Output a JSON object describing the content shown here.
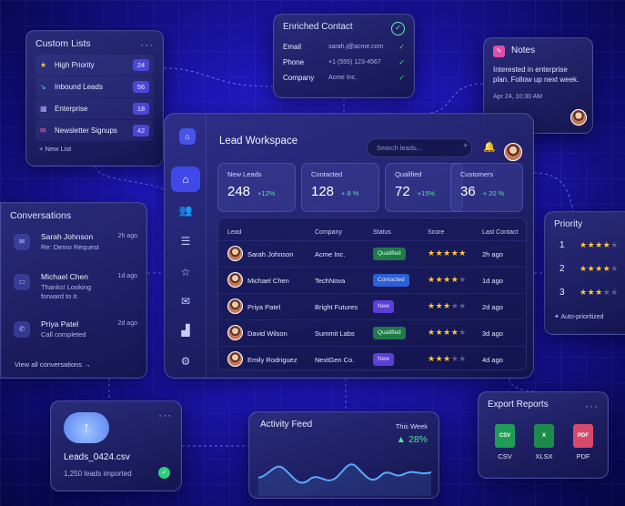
{
  "custom_lists": {
    "title": "Custom Lists",
    "items": [
      {
        "label": "High Priority",
        "count": "24",
        "icon": "star-icon"
      },
      {
        "label": "Inbound Leads",
        "count": "56",
        "icon": "arrow-in-icon"
      },
      {
        "label": "Enterprise",
        "count": "18",
        "icon": "building-icon"
      },
      {
        "label": "Newsletter Signups",
        "count": "42",
        "icon": "mail-icon"
      }
    ],
    "new_list": "+ New List"
  },
  "enriched_contact": {
    "title": "Enriched Contact",
    "rows": [
      {
        "key": "Email",
        "value": "sarah.j@acme.com"
      },
      {
        "key": "Phone",
        "value": "+1 (555) 123-4567"
      },
      {
        "key": "Company",
        "value": "Acme Inc."
      }
    ]
  },
  "notes": {
    "title": "Notes",
    "text": "Interested in enterprise plan. Follow up next week.",
    "time": "Apr 24, 10:30 AM"
  },
  "workspace": {
    "title": "Lead Workspace",
    "search_placeholder": "Search leads...",
    "stats": [
      {
        "label": "New Leads",
        "value": "248",
        "change": "+12%"
      },
      {
        "label": "Contacted",
        "value": "128",
        "change": "+ 8 %"
      },
      {
        "label": "Qualified",
        "value": "72",
        "change": "+15%"
      },
      {
        "label": "Customers",
        "value": "36",
        "change": "+ 20 %"
      }
    ],
    "columns": [
      "Lead",
      "Company",
      "Status",
      "Score",
      "Last Contact"
    ],
    "rows": [
      {
        "lead": "Sarah Johnson",
        "company": "Acme Inc.",
        "status": "Qualified",
        "score": 5,
        "last": "2h ago"
      },
      {
        "lead": "Michael Chen",
        "company": "TechNova",
        "status": "Contacted",
        "score": 4,
        "last": "1d ago"
      },
      {
        "lead": "Priya Patel",
        "company": "Bright Futures",
        "status": "New",
        "score": 3,
        "last": "2d ago"
      },
      {
        "lead": "David Wilson",
        "company": "Summit Labs",
        "status": "Qualified",
        "score": 4,
        "last": "3d ago"
      },
      {
        "lead": "Emily Rodriguez",
        "company": "NextGen Co.",
        "status": "New",
        "score": 3,
        "last": "4d ago"
      }
    ]
  },
  "conversations": {
    "title": "Conversations",
    "items": [
      {
        "name": "Sarah Johnson",
        "message": "Re: Demo Request",
        "time": "2h ago",
        "icon": "mail-icon"
      },
      {
        "name": "Michael Chen",
        "message": "Thanks! Looking forward to it.",
        "time": "1d ago",
        "icon": "chat-icon"
      },
      {
        "name": "Priya Patel",
        "message": "Call completed",
        "time": "2d ago",
        "icon": "phone-icon"
      }
    ],
    "view_all": "View all conversations →"
  },
  "priority": {
    "title": "Priority",
    "rows": [
      {
        "rank": "1",
        "stars": 4
      },
      {
        "rank": "2",
        "stars": 4
      },
      {
        "rank": "3",
        "stars": 3
      }
    ],
    "auto": "Auto-prioritized"
  },
  "file_card": {
    "file_name": "Leads_0424.csv",
    "subtitle": "1,250 leads imported"
  },
  "activity": {
    "title": "Activity Feed",
    "period": "This Week",
    "change": "▲ 28%"
  },
  "export": {
    "title": "Export Reports",
    "formats": [
      {
        "label": "CSV",
        "color": "#1f9d57"
      },
      {
        "label": "XLSX",
        "color": "#1d8b4c"
      },
      {
        "label": "PDF",
        "color": "#d64b6d"
      }
    ]
  },
  "colors": {
    "accent": "#3f49e8",
    "success": "#4ee49a",
    "star": "#ffc83a"
  }
}
